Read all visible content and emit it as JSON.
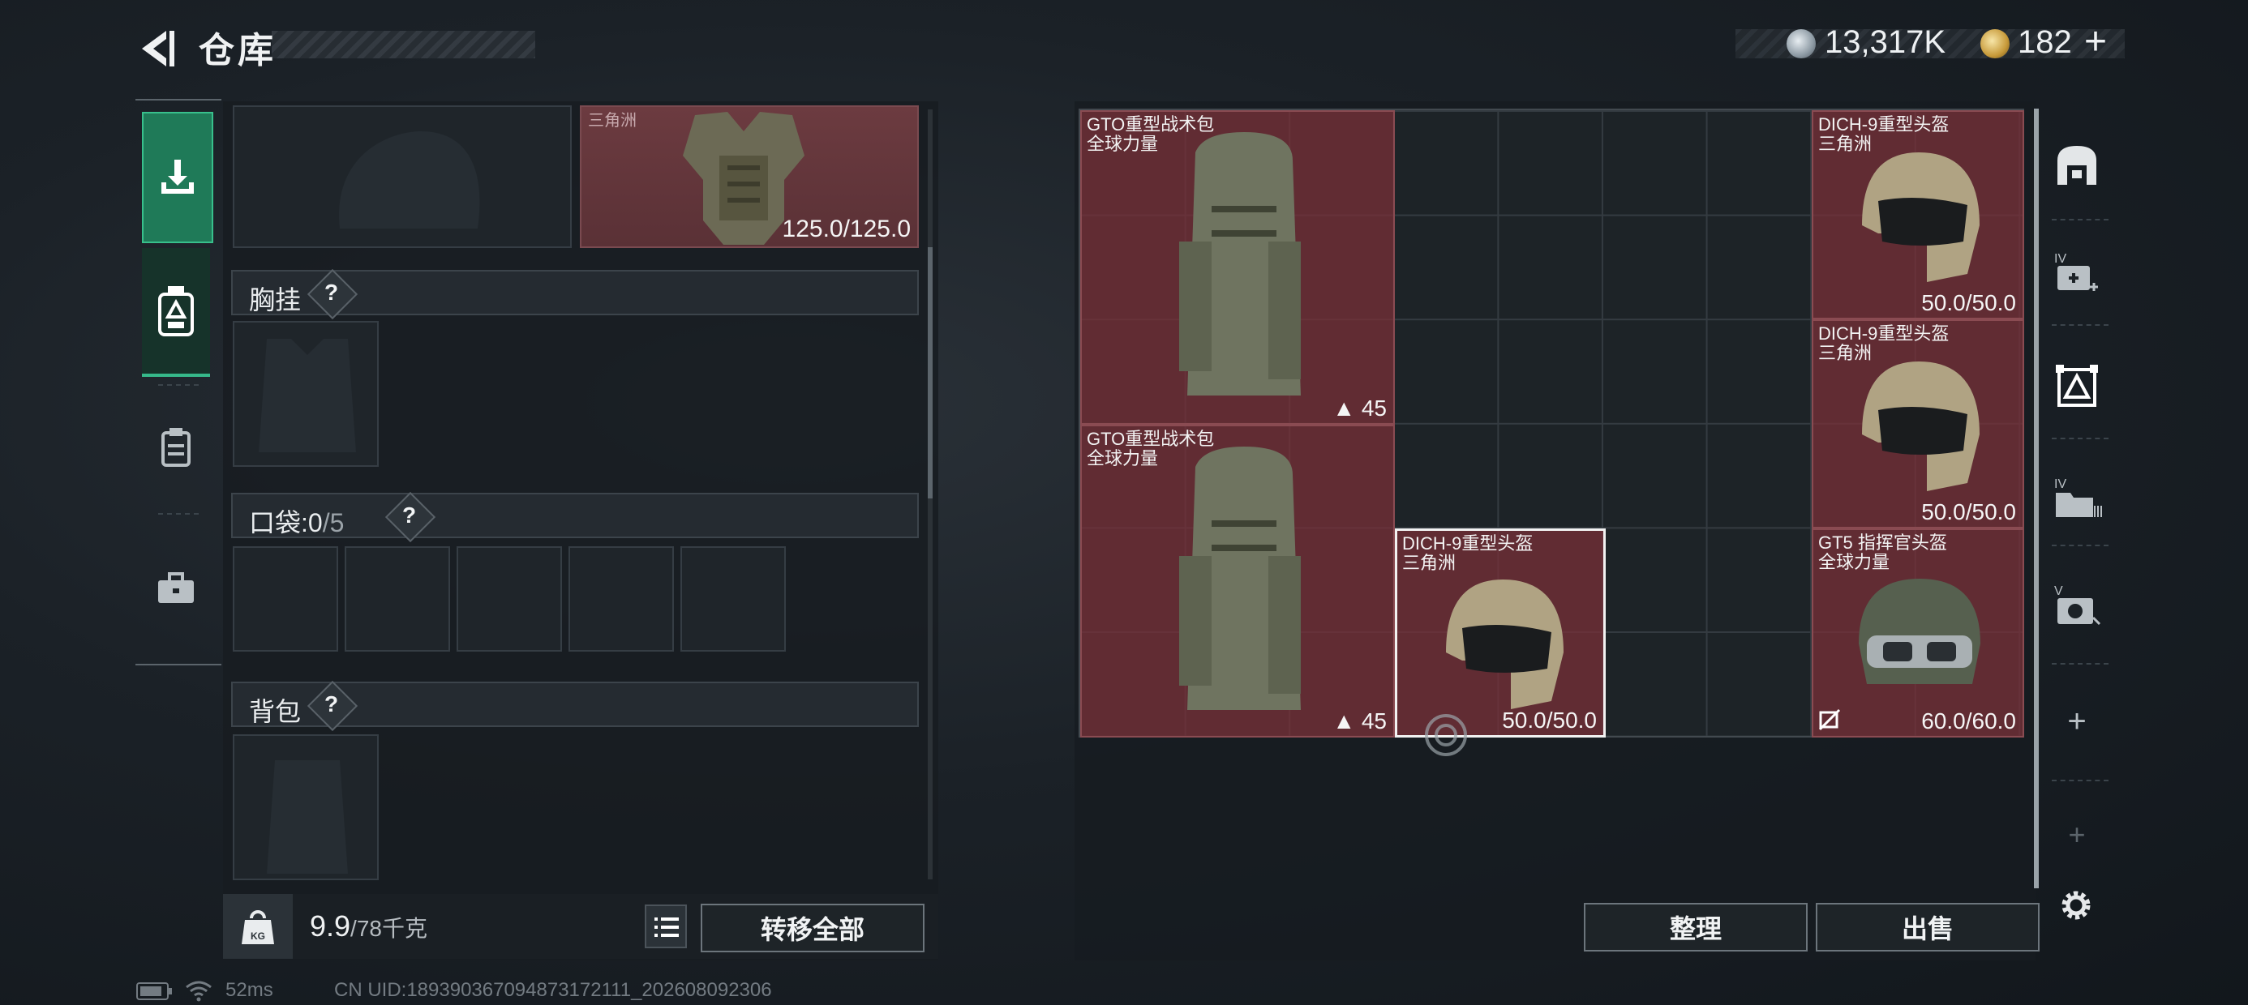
{
  "header": {
    "title": "仓库",
    "currency_silver": "13,317K",
    "currency_gold": "182",
    "add_label": "+"
  },
  "left_tabs": [
    {
      "icon": "download-icon",
      "active": true
    },
    {
      "icon": "equipment-icon",
      "active": false
    },
    {
      "icon": "clipboard-icon",
      "active": false
    },
    {
      "icon": "briefcase-icon",
      "active": false
    }
  ],
  "armor": {
    "brand": "三角洲",
    "durability": "125.0/125.0"
  },
  "sections": {
    "chest": {
      "label": "胸挂",
      "q": "?"
    },
    "pocket": {
      "label": "口袋:",
      "count": "0",
      "total": "/5",
      "q": "?"
    },
    "backpack": {
      "label": "背包",
      "q": "?"
    }
  },
  "footer": {
    "weight": "9.9",
    "capacity": "/78千克",
    "kg_label": "KG",
    "transfer_all": "转移全部",
    "sort": "整理",
    "sell": "出售"
  },
  "grid_items": [
    {
      "name": "GTO重型战术包",
      "brand": "全球力量",
      "count": "45"
    },
    {
      "name": "GTO重型战术包",
      "brand": "全球力量",
      "count": "45"
    },
    {
      "name": "DICH-9重型头盔",
      "brand": "三角洲",
      "durability": "50.0/50.0"
    },
    {
      "name": "DICH-9重型头盔",
      "brand": "三角洲",
      "durability": "50.0/50.0"
    },
    {
      "name": "DICH-9重型头盔",
      "brand": "三角洲",
      "durability": "50.0/50.0"
    },
    {
      "name": "GT5 指挥官头盔",
      "brand": "全球力量",
      "durability": "60.0/60.0"
    }
  ],
  "right_tabs": [
    {
      "icon": "safe-box-icon",
      "label": ""
    },
    {
      "icon": "expand-case-icon",
      "label": "IV"
    },
    {
      "icon": "equipment-case-icon",
      "label": ""
    },
    {
      "icon": "folder-case-icon",
      "label": "IV"
    },
    {
      "icon": "camera-case-icon",
      "label": "V"
    },
    {
      "icon": "add-icon",
      "label": "+"
    },
    {
      "icon": "add-icon",
      "label": "+"
    }
  ],
  "status": {
    "ping": "52ms",
    "uid": "CN UID:189390367094873172111_202608092306"
  }
}
